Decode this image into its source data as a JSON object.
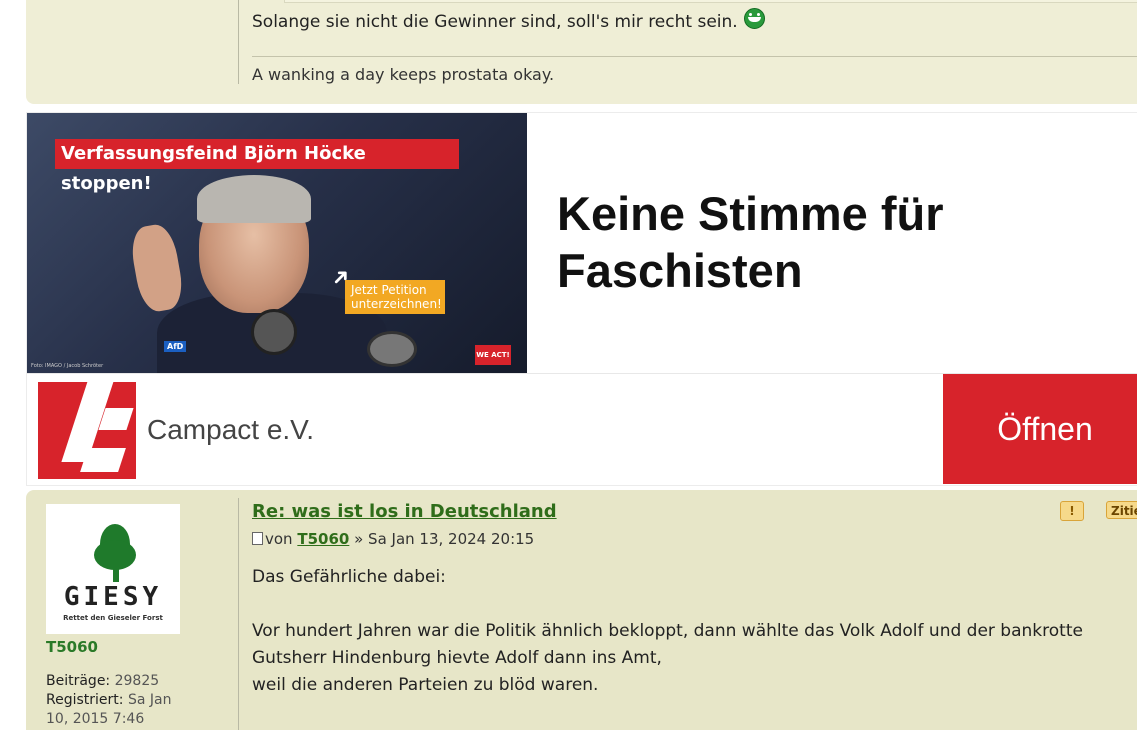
{
  "previous_post": {
    "text": "Solange sie nicht die Gewinner sind, soll's mir recht sein.",
    "smiley_icon": "grin-smiley-icon",
    "signature": "A wanking a day keeps prostata okay."
  },
  "ad": {
    "banner_text": "Verfassungsfeind Björn Höcke stoppen!",
    "petition_line1": "Jetzt Petition",
    "petition_line2": "unterzeichnen!",
    "party_badge": "AfD",
    "photo_credit": "Foto: IMAGO / Jacob Schröter",
    "small_logo": "WE ACT!",
    "headline_line1": "Keine Stimme für",
    "headline_line2": "Faschisten",
    "advertiser": "Campact e.V.",
    "cta": "Öffnen",
    "brand_color": "#d7232b"
  },
  "post": {
    "title": "Re: was ist los in Deutschland",
    "meta_prefix": "von",
    "author": "T5060",
    "date": "» Sa Jan 13, 2024 20:15",
    "body_line1": "Das Gefährliche dabei:",
    "body_line2": "Vor hundert Jahren war die Politik ähnlich bekloppt, dann wählte das Volk Adolf und der bankrotte",
    "body_line3": "Gutsherr Hindenburg hievte Adolf dann ins Amt,",
    "body_line4": "weil die anderen Parteien zu blöd waren.",
    "report_label": "!",
    "quote_label": "Zitie",
    "accent_color": "#2f6d1a"
  },
  "profile": {
    "avatar_title": "GIESY",
    "avatar_claim": "Rettet den Gieseler Forst",
    "username": "T5060",
    "posts_label": "Beiträge:",
    "posts_value": "29825",
    "registered_label": "Registriert:",
    "registered_value": "Sa Jan",
    "registered_cont": "10, 2015 7:46"
  }
}
